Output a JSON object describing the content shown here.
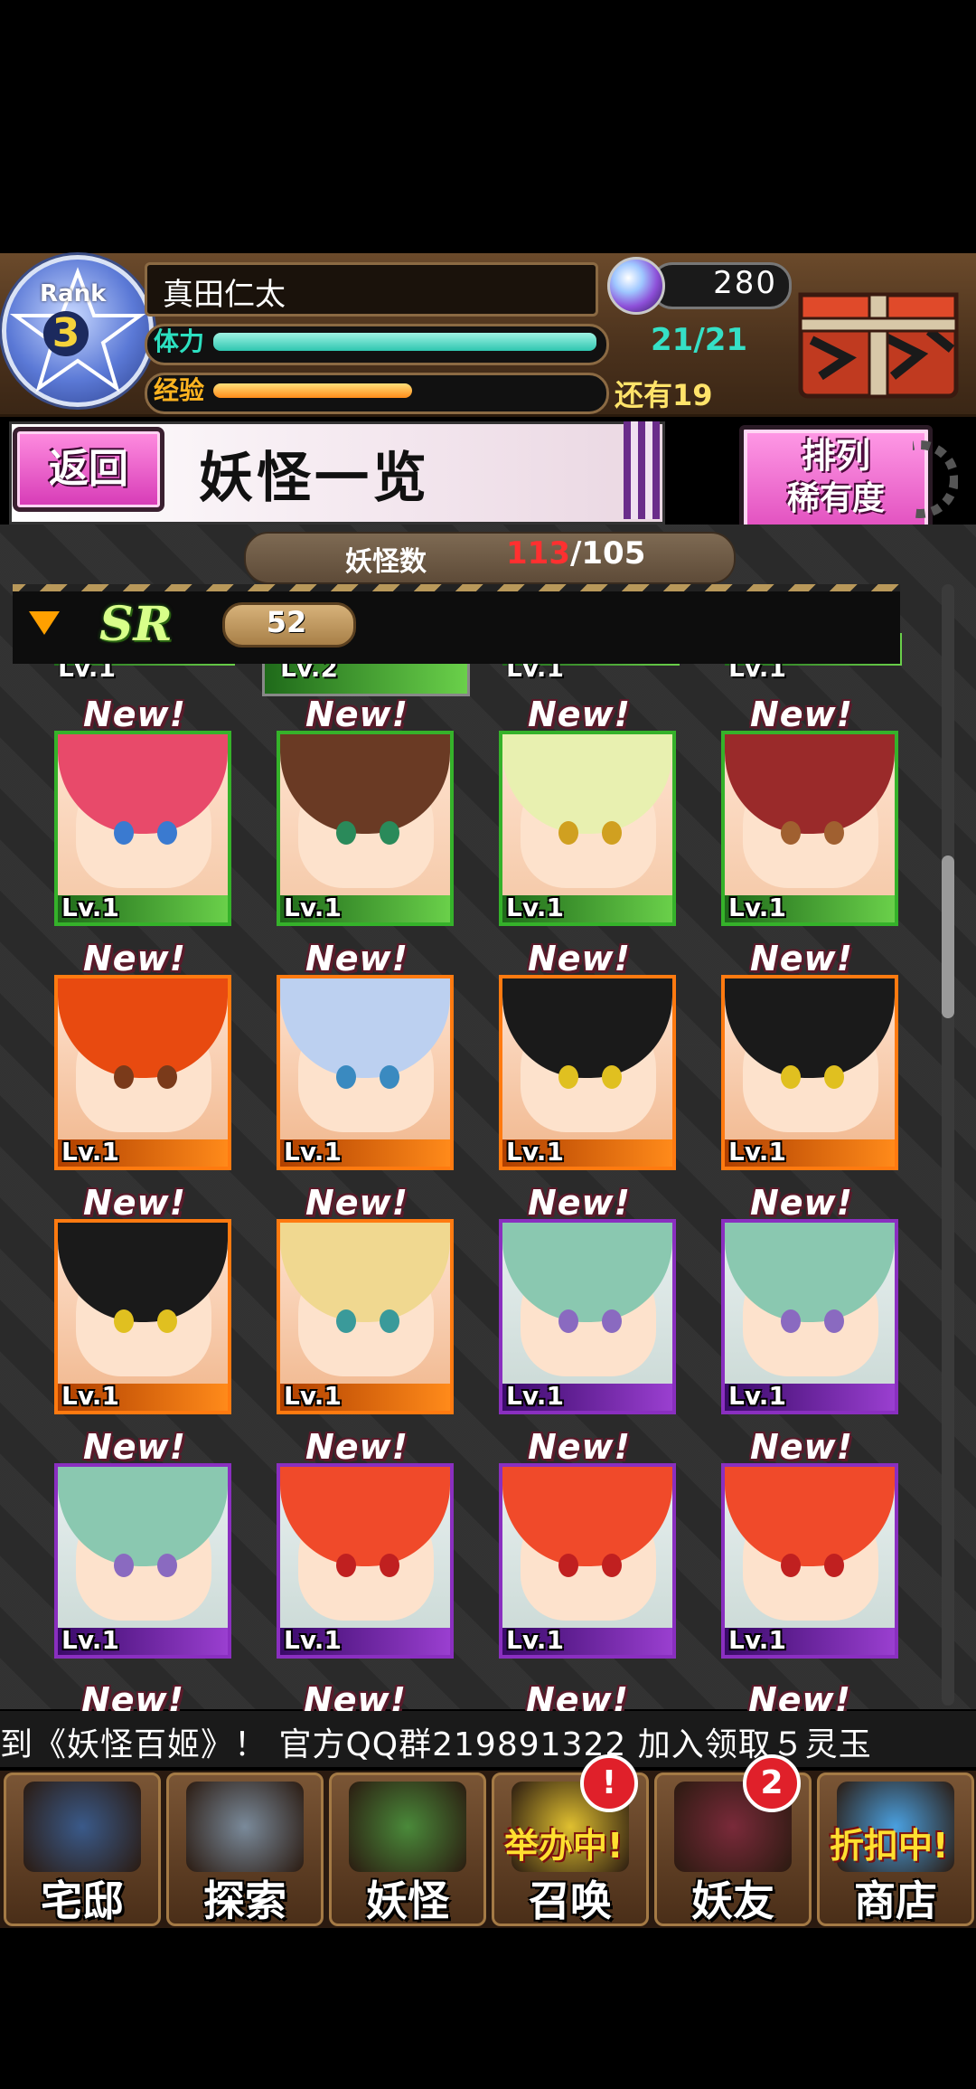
{
  "header": {
    "rank_label": "Rank",
    "rank_value": "3",
    "player_name": "真田仁太",
    "gems": "280",
    "stamina_label": "体力",
    "stamina_value": "21/21",
    "stamina_fraction": 1.0,
    "exp_label": "经验",
    "exp_remaining": "还有19",
    "exp_fraction": 0.52
  },
  "titlebar": {
    "back_label": "返回",
    "title": "妖怪一览",
    "sort_label": "排列",
    "sort_value": "稀有度"
  },
  "counter": {
    "label": "妖怪数",
    "current": "113",
    "separator": "/105"
  },
  "section": {
    "badge": "SR",
    "count": "52"
  },
  "partial_row": [
    "Lv.1",
    "Lv.2",
    "Lv.1",
    "Lv.1"
  ],
  "cards": [
    {
      "tag": "New!",
      "level": "Lv.1",
      "frame": "green",
      "hair": "#e84a6a",
      "eyes": "#3a7ad0"
    },
    {
      "tag": "New!",
      "level": "Lv.1",
      "frame": "green",
      "hair": "#6a3a24",
      "eyes": "#2a8a5a"
    },
    {
      "tag": "New!",
      "level": "Lv.1",
      "frame": "green",
      "hair": "#e8f0b0",
      "eyes": "#d0a020"
    },
    {
      "tag": "New!",
      "level": "Lv.1",
      "frame": "green",
      "hair": "#9a2a2a",
      "eyes": "#a06030"
    },
    {
      "tag": "New!",
      "level": "Lv.1",
      "frame": "orange",
      "hair": "#e84a10",
      "eyes": "#7a3a1a"
    },
    {
      "tag": "New!",
      "level": "Lv.1",
      "frame": "orange",
      "hair": "#bcd0f0",
      "eyes": "#3a8ac0"
    },
    {
      "tag": "New!",
      "level": "Lv.1",
      "frame": "orange",
      "hair": "#1a1a1a",
      "eyes": "#e0c020"
    },
    {
      "tag": "New!",
      "level": "Lv.1",
      "frame": "orange",
      "hair": "#1a1a1a",
      "eyes": "#e0c020"
    },
    {
      "tag": "New!",
      "level": "Lv.1",
      "frame": "orange",
      "hair": "#1a1a1a",
      "eyes": "#e0c020"
    },
    {
      "tag": "New!",
      "level": "Lv.1",
      "frame": "orange",
      "hair": "#f0d890",
      "eyes": "#3a9a9a"
    },
    {
      "tag": "New!",
      "level": "Lv.1",
      "frame": "purple",
      "hair": "#8ac8b0",
      "eyes": "#8a6ac0"
    },
    {
      "tag": "New!",
      "level": "Lv.1",
      "frame": "purple",
      "hair": "#8ac8b0",
      "eyes": "#8a6ac0"
    },
    {
      "tag": "New!",
      "level": "Lv.1",
      "frame": "purple",
      "hair": "#8ac8b0",
      "eyes": "#8a6ac0"
    },
    {
      "tag": "New!",
      "level": "Lv.1",
      "frame": "purple",
      "hair": "#f04a2a",
      "eyes": "#c02020"
    },
    {
      "tag": "New!",
      "level": "Lv.1",
      "frame": "purple",
      "hair": "#f04a2a",
      "eyes": "#c02020"
    },
    {
      "tag": "New!",
      "level": "Lv.1",
      "frame": "purple",
      "hair": "#f04a2a",
      "eyes": "#c02020"
    }
  ],
  "next_row_tags": [
    "New!",
    "New!",
    "New!",
    "New!"
  ],
  "ticker": "到《妖怪百姬》！ 官方QQ群219891322     加入领取５灵玉",
  "nav": [
    {
      "label": "宅邸",
      "icon": "mansion-icon"
    },
    {
      "label": "探索",
      "icon": "magnifier-map-icon"
    },
    {
      "label": "妖怪",
      "icon": "yokai-scroll-icon"
    },
    {
      "label": "召唤",
      "icon": "summon-icon",
      "promo": "举办中!",
      "alert": "!"
    },
    {
      "label": "妖友",
      "icon": "friend-icon",
      "alert": "2"
    },
    {
      "label": "商店",
      "icon": "shop-orb-icon",
      "promo": "折扣中!"
    }
  ]
}
